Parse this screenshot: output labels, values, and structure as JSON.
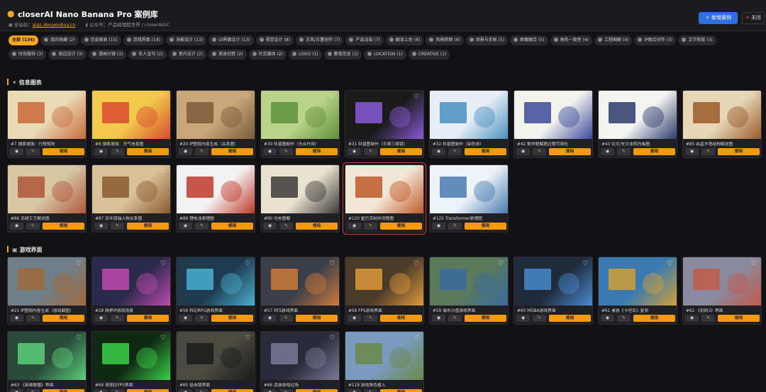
{
  "header": {
    "logo_icon": "banana-emoji-icon",
    "title": "closerAI Nano Banana Pro 案例库",
    "site_label": "全站站：",
    "site_link": "aigc.douyoubuy.cn",
    "account_label": "公众号：产品经理超世界 / closerAIGC",
    "new_button": "＋ 新增案例",
    "close_button": "关闭"
  },
  "filters": {
    "row1": [
      {
        "label": "全部 (134)",
        "active": true
      },
      {
        "label": "我的收藏 (2)"
      },
      {
        "label": "信息图表 (15)"
      },
      {
        "label": "游戏界面 (14)"
      },
      {
        "label": "海报设计 (13)"
      },
      {
        "label": "UI界面设计 (13)"
      },
      {
        "label": "视觉设计 (8)"
      },
      {
        "label": "古风/古董创作 (7)"
      },
      {
        "label": "产品渲染 (7)"
      },
      {
        "label": "翻译上色 (6)"
      },
      {
        "label": "风格转换 (6)"
      },
      {
        "label": "场景与手账 (5)"
      },
      {
        "label": "图像融合 (5)"
      },
      {
        "label": "角色一致性 (4)"
      },
      {
        "label": "工程图解 (4)"
      },
      {
        "label": "IP融合创作 (3)"
      },
      {
        "label": "文字排版 (3)"
      }
    ],
    "row2": [
      {
        "label": "时尚服饰 (3)"
      },
      {
        "label": "周边设计 (3)"
      },
      {
        "label": "漫画分镜 (3)"
      },
      {
        "label": "名人金句 (2)"
      },
      {
        "label": "室内设计 (2)"
      },
      {
        "label": "美食创意 (2)"
      },
      {
        "label": "社交媒体 (2)"
      },
      {
        "label": "LOGO (1)"
      },
      {
        "label": "教育信息 (1)"
      },
      {
        "label": "LOCATION (1)"
      },
      {
        "label": "CREATIVE (1)"
      }
    ]
  },
  "sections": [
    {
      "title": "信息图表",
      "icon": "tools-icon",
      "cards": [
        {
          "caption": "#7 搜索增强：行程规划",
          "c1": "#e9d9b5",
          "c2": "#c96a3a"
        },
        {
          "caption": "#8 搜索增强：天气信息图",
          "c1": "#f2c94c",
          "c2": "#d94c2f"
        },
        {
          "caption": "#20 IP图视内容生成（关系图）",
          "c1": "#c9a77a",
          "c2": "#7a5a3a"
        },
        {
          "caption": "#30 科普图制作（光合作用）",
          "c1": "#b9d48a",
          "c2": "#5f8f3a"
        },
        {
          "caption": "#31 科普图制作（牛顿三棱镜）",
          "c1": "#1a1a1a",
          "c2": "#8a5bd6"
        },
        {
          "caption": "#32 科普图制作（染色体）",
          "c1": "#e8eef5",
          "c2": "#4a8fc0"
        },
        {
          "caption": "#42 数学题解题过程可视化",
          "c1": "#f3f3ee",
          "c2": "#3a4a9a"
        },
        {
          "caption": "#43 论文/长文本转白板图",
          "c1": "#f4f4f2",
          "c2": "#2a3a6a"
        },
        {
          "caption": "#85 启昌木塔结构解说图",
          "c1": "#e6d6b6",
          "c2": "#9a5a2a"
        },
        {
          "caption": "#86 苏绣工艺解说图",
          "c1": "#d7c6a4",
          "c2": "#b0563a"
        },
        {
          "caption": "#87 百年孤独人物关系图",
          "c1": "#d9c29a",
          "c2": "#8a5a2e"
        },
        {
          "caption": "#88 锂电池原理图",
          "c1": "#f2f2f2",
          "c2": "#c0392b"
        },
        {
          "caption": "#90 功夫图解",
          "c1": "#e9e2cf",
          "c2": "#3a3a3a"
        },
        {
          "caption": "#120 星巴克制作流程图",
          "c1": "#f2e6d6",
          "c2": "#c05a2a",
          "selected": true
        },
        {
          "caption": "#125 Transformer原理图",
          "c1": "#eef3f7",
          "c2": "#4a7ab0"
        }
      ]
    },
    {
      "title": "游戏界面",
      "icon": "gamepad-icon",
      "cards": [
        {
          "caption": "#21 IP图视内容生成（游戏截图）",
          "c1": "#6f7f8a",
          "c2": "#a06a3a"
        },
        {
          "caption": "#28 跨界IP游戏场景",
          "c1": "#2a2a4a",
          "c2": "#c04ab0"
        },
        {
          "caption": "#56 科幻RPG游戏界面",
          "c1": "#1f3a4f",
          "c2": "#4ab0d0"
        },
        {
          "caption": "#57 RTS游戏界面",
          "c1": "#3a3f4a",
          "c2": "#d07a3a"
        },
        {
          "caption": "#58 FPS游戏界面",
          "c1": "#4a3a2a",
          "c2": "#e09a3a"
        },
        {
          "caption": "#59 城市沙盘游戏界面",
          "c1": "#5a7a5a",
          "c2": "#3a6aa0"
        },
        {
          "caption": "#60 MOBA游戏界面",
          "c1": "#1f2a3a",
          "c2": "#4a8ad0"
        },
        {
          "caption": "#61 桌游《卡坦岛》复刻",
          "c1": "#3a7ab0",
          "c2": "#d0a03a"
        },
        {
          "caption": "#62 《剑网3》界面",
          "c1": "#8a8aa0",
          "c2": "#c05a4a"
        },
        {
          "caption": "#63 《英雄联盟》界面",
          "c1": "#2a4a3a",
          "c2": "#5ad07a"
        },
        {
          "caption": "#64 夜视仪FPS界面",
          "c1": "#0f2a12",
          "c2": "#3ad04a"
        },
        {
          "caption": "#65 狙击镜界面",
          "c1": "#4a4a40",
          "c2": "#1a1a1a"
        },
        {
          "caption": "#66 武侠游戏过场",
          "c1": "#2a2a3a",
          "c2": "#7a7a9a"
        },
        {
          "caption": "#119 游戏角色植入",
          "c1": "#7a9ac0",
          "c2": "#6a8a4a"
        }
      ]
    }
  ],
  "card_actions": {
    "view_icon": "eye-icon",
    "edit_icon": "pencil-icon",
    "use_label": "使用",
    "favorite_icon": "heart-icon"
  }
}
